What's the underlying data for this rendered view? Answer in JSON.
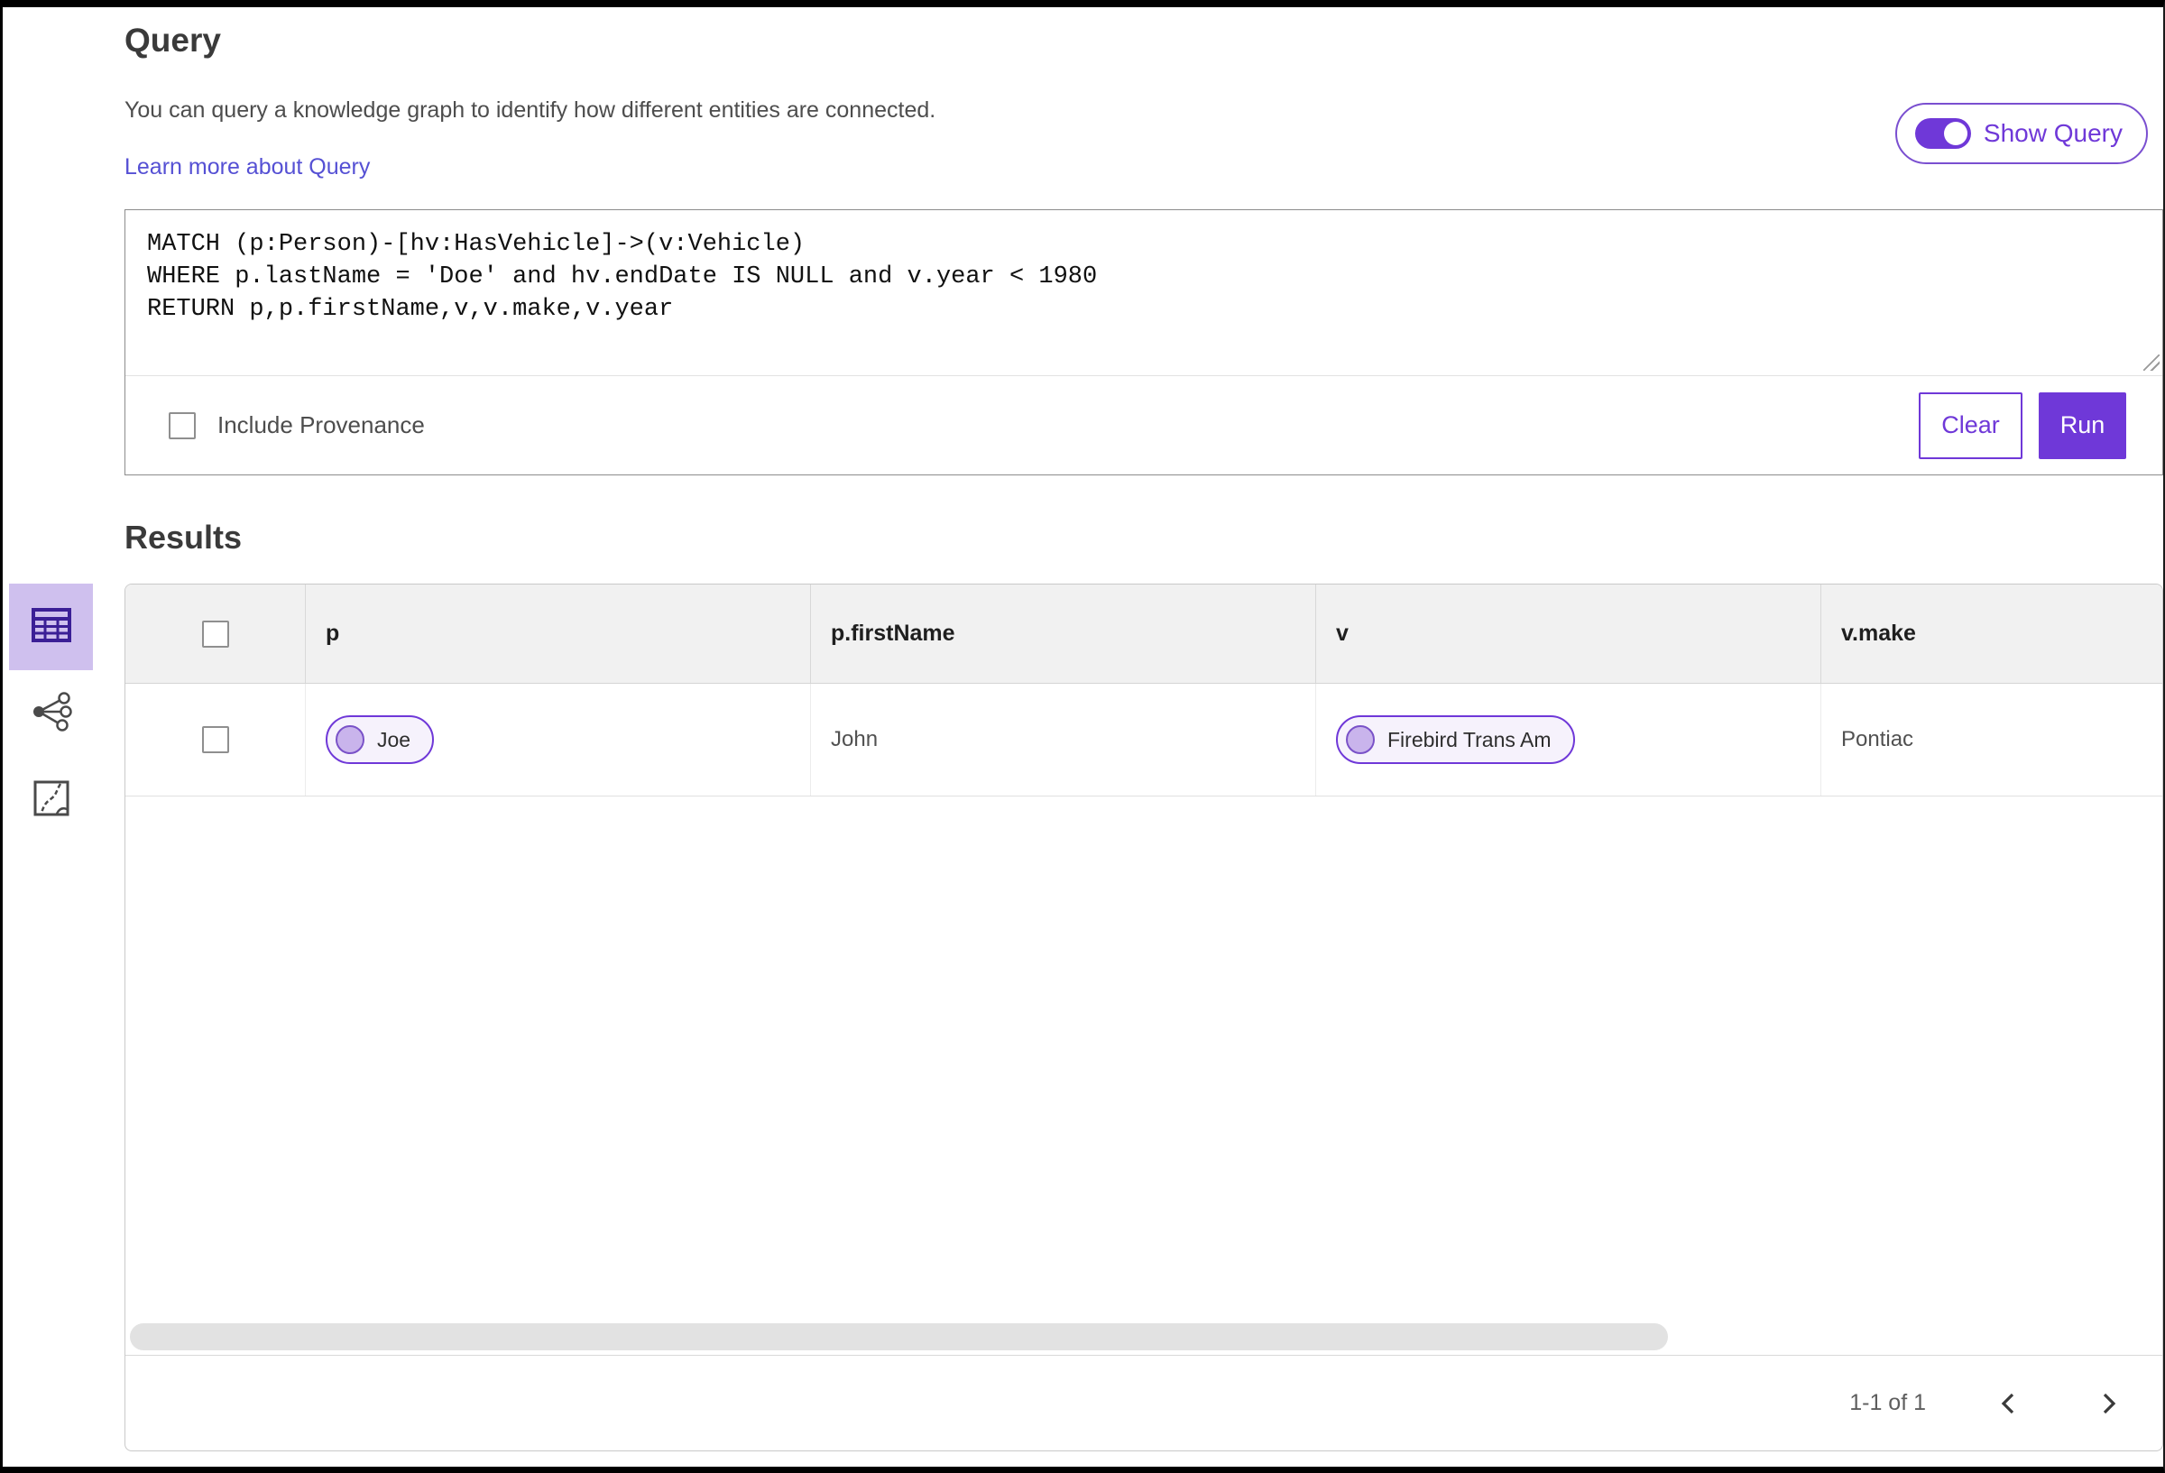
{
  "header": {
    "title": "Query",
    "description": "You can query a knowledge graph to identify how different entities are connected.",
    "learn_more_label": "Learn more about Query",
    "show_query_label": "Show Query",
    "show_query_on": true
  },
  "query_editor": {
    "text": "MATCH (p:Person)-[hv:HasVehicle]->(v:Vehicle)\nWHERE p.lastName = 'Doe' and hv.endDate IS NULL and v.year < 1980\nRETURN p,p.firstName,v,v.make,v.year",
    "include_provenance_label": "Include Provenance",
    "include_provenance_checked": false,
    "clear_label": "Clear",
    "run_label": "Run"
  },
  "results": {
    "title": "Results",
    "views": [
      {
        "name": "table-view",
        "selected": true
      },
      {
        "name": "network-view",
        "selected": false
      },
      {
        "name": "map-view",
        "selected": false
      }
    ],
    "columns": [
      "p",
      "p.firstName",
      "v",
      "v.make"
    ],
    "rows": [
      {
        "p": "Joe",
        "firstName": "John",
        "v": "Firebird Trans Am",
        "make": "Pontiac"
      }
    ],
    "pagination": {
      "range_label": "1-1 of 1"
    }
  },
  "colors": {
    "accent_purple": "#6f38d8",
    "link_purple": "#5550d4",
    "selected_view_bg": "#cfc0ee",
    "view_icon_selected": "#3b1f96",
    "pill_bg": "#f6f2fc",
    "pill_avatar_fill": "#c9b4ec",
    "table_header_bg": "#f1f1f1"
  }
}
